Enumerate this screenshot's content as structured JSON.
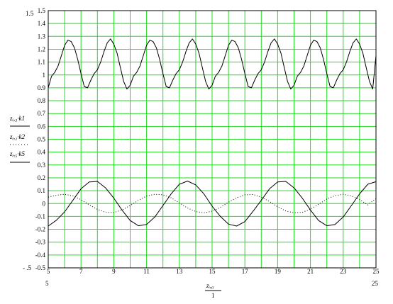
{
  "chart_data": {
    "type": "line",
    "colors": {
      "grid": "#22dd22",
      "frame": "#000000",
      "line": "#000000",
      "background": "#ffffff"
    },
    "xlim": [
      5,
      25
    ],
    "ylim": [
      -0.5,
      1.5
    ],
    "grid": true,
    "x_ticks": [
      "5",
      "7",
      "9",
      "11",
      "13",
      "15",
      "17",
      "19",
      "21",
      "23",
      "25"
    ],
    "y_ticks": [
      "1.5",
      "1.4",
      "1.3",
      "1.2",
      "1.1",
      "1",
      "0.9",
      "0.8",
      "0.7",
      "0.6",
      "0.5",
      "0.4",
      "0.3",
      "0.2",
      "0.1",
      "0",
      "-0.1",
      "-0.2",
      "-0.3",
      "-0.4",
      "-0.5"
    ],
    "y_top_limit_label": "1.5",
    "y_bottom_limit_label": "- .5",
    "x_left_limit_label": "5",
    "x_right_limit_label": "25",
    "ylabels": [
      "zᵢ,₃·k1",
      "zᵢ,₂·k2",
      "zᵢ,₅·k5"
    ],
    "xlabel_numerator": "zᵢ,₀",
    "xlabel_denominator": "1",
    "series": [
      {
        "style": "solid",
        "x": [
          5,
          5.2,
          5.4,
          5.6,
          5.8,
          6,
          6.2,
          6.4,
          6.6,
          6.8,
          7,
          7.2,
          7.4,
          7.6,
          7.8,
          8,
          8.2,
          8.4,
          8.6,
          8.8,
          9,
          9.2,
          9.4,
          9.6,
          9.8,
          10,
          10.2,
          10.4,
          10.6,
          10.8,
          11,
          11.2,
          11.4,
          11.6,
          11.8,
          12,
          12.2,
          12.4,
          12.6,
          12.8,
          13,
          13.2,
          13.4,
          13.6,
          13.8,
          14,
          14.2,
          14.4,
          14.6,
          14.8,
          15,
          15.2,
          15.4,
          15.6,
          15.8,
          16,
          16.2,
          16.4,
          16.6,
          16.8,
          17,
          17.2,
          17.4,
          17.6,
          17.8,
          18,
          18.2,
          18.4,
          18.6,
          18.8,
          19,
          19.2,
          19.4,
          19.6,
          19.8,
          20,
          20.2,
          20.4,
          20.6,
          20.8,
          21,
          21.2,
          21.4,
          21.6,
          21.8,
          22,
          22.2,
          22.4,
          22.6,
          22.8,
          23,
          23.2,
          23.4,
          23.6,
          23.8,
          24,
          24.2,
          24.4,
          24.6,
          24.8,
          25
        ],
        "values": [
          0.9,
          0.99,
          1.02,
          1.07,
          1.15,
          1.23,
          1.27,
          1.26,
          1.21,
          1.12,
          1.01,
          0.91,
          0.9,
          0.96,
          1.01,
          1.04,
          1.1,
          1.18,
          1.25,
          1.28,
          1.24,
          1.17,
          1.06,
          0.95,
          0.89,
          0.92,
          0.99,
          1.02,
          1.07,
          1.15,
          1.23,
          1.27,
          1.26,
          1.21,
          1.12,
          1.01,
          0.91,
          0.9,
          0.96,
          1.01,
          1.04,
          1.1,
          1.18,
          1.25,
          1.28,
          1.24,
          1.17,
          1.06,
          0.95,
          0.89,
          0.92,
          0.99,
          1.02,
          1.07,
          1.15,
          1.23,
          1.27,
          1.26,
          1.21,
          1.12,
          1.01,
          0.91,
          0.9,
          0.96,
          1.01,
          1.04,
          1.1,
          1.18,
          1.25,
          1.28,
          1.24,
          1.17,
          1.06,
          0.95,
          0.89,
          0.92,
          0.99,
          1.02,
          1.07,
          1.15,
          1.23,
          1.27,
          1.26,
          1.21,
          1.12,
          1.01,
          0.91,
          0.9,
          0.96,
          1.01,
          1.04,
          1.1,
          1.18,
          1.25,
          1.28,
          1.24,
          1.17,
          1.06,
          0.95,
          0.89,
          1.15
        ]
      },
      {
        "style": "solid",
        "x": [
          5,
          5.5,
          6,
          6.5,
          7,
          7.5,
          8,
          8.5,
          9,
          9.5,
          10,
          10.5,
          11,
          11.5,
          12,
          12.5,
          13,
          13.5,
          14,
          14.5,
          15,
          15.5,
          16,
          16.5,
          17,
          17.5,
          18,
          18.5,
          19,
          19.5,
          20,
          20.5,
          21,
          21.5,
          22,
          22.5,
          23,
          23.5,
          24,
          24.5,
          25
        ],
        "values": [
          -0.175,
          -0.13,
          -0.065,
          0.025,
          0.115,
          0.168,
          0.172,
          0.122,
          0.042,
          -0.05,
          -0.132,
          -0.173,
          -0.163,
          -0.105,
          -0.015,
          0.075,
          0.15,
          0.175,
          0.145,
          0.075,
          -0.02,
          -0.1,
          -0.16,
          -0.175,
          -0.14,
          -0.06,
          0.025,
          0.115,
          0.168,
          0.172,
          0.122,
          0.042,
          -0.05,
          -0.132,
          -0.173,
          -0.163,
          -0.105,
          -0.015,
          0.075,
          0.15,
          0.17
        ]
      },
      {
        "style": "dotted",
        "x": [
          5,
          5.5,
          6,
          6.5,
          7,
          7.5,
          8,
          8.5,
          9,
          9.5,
          10,
          10.5,
          11,
          11.5,
          12,
          12.5,
          13,
          13.5,
          14,
          14.5,
          15,
          15.5,
          16,
          16.5,
          17,
          17.5,
          18,
          18.5,
          19,
          19.5,
          20,
          20.5,
          21,
          21.5,
          22,
          22.5,
          23,
          23.5,
          24,
          24.5,
          25
        ],
        "values": [
          0.05,
          0.065,
          0.072,
          0.06,
          0.03,
          -0.01,
          -0.045,
          -0.068,
          -0.07,
          -0.05,
          -0.015,
          0.025,
          0.058,
          0.072,
          0.068,
          0.045,
          0.005,
          -0.035,
          -0.062,
          -0.072,
          -0.06,
          -0.03,
          0.01,
          0.045,
          0.068,
          0.07,
          0.05,
          0.015,
          -0.025,
          -0.058,
          -0.072,
          -0.068,
          -0.045,
          -0.005,
          0.035,
          0.062,
          0.072,
          0.06,
          0.03,
          -0.01,
          0.04
        ]
      }
    ]
  }
}
